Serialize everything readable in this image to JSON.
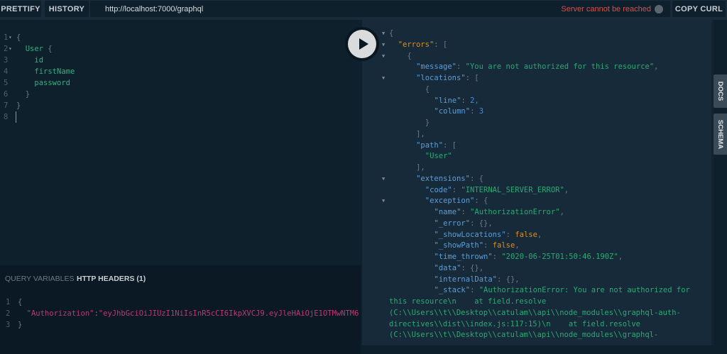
{
  "toolbar": {
    "prettify": "PRETTIFY",
    "history": "HISTORY",
    "url": "http://localhost:7000/graphql",
    "status": "Server cannot be reached",
    "copy_curl": "COPY CURL"
  },
  "side_tabs": {
    "docs": "DOCS",
    "schema": "SCHEMA"
  },
  "query": {
    "lines": [
      {
        "n": "1",
        "fold": true,
        "indent": 0,
        "tokens": [
          {
            "t": "{",
            "c": "punc"
          }
        ]
      },
      {
        "n": "2",
        "fold": true,
        "indent": 1,
        "tokens": [
          {
            "t": "User",
            "c": "green"
          },
          {
            "t": " {",
            "c": "punc"
          }
        ]
      },
      {
        "n": "3",
        "indent": 2,
        "tokens": [
          {
            "t": "id",
            "c": "green"
          }
        ]
      },
      {
        "n": "4",
        "indent": 2,
        "tokens": [
          {
            "t": "firstName",
            "c": "green"
          }
        ]
      },
      {
        "n": "5",
        "indent": 2,
        "tokens": [
          {
            "t": "password",
            "c": "green"
          }
        ]
      },
      {
        "n": "6",
        "indent": 1,
        "tokens": [
          {
            "t": "}",
            "c": "punc"
          }
        ]
      },
      {
        "n": "7",
        "indent": 0,
        "tokens": [
          {
            "t": "}",
            "c": "punc"
          }
        ]
      },
      {
        "n": "8",
        "indent": 0,
        "tokens": []
      }
    ]
  },
  "bottom_panel": {
    "tabs": [
      "QUERY VARIABLES",
      "HTTP HEADERS (1)"
    ],
    "active": 1,
    "lines": [
      {
        "n": "1",
        "tokens": [
          {
            "t": "{",
            "c": "punc"
          }
        ]
      },
      {
        "n": "2",
        "tokens": [
          {
            "t": "  \"Authorization\"",
            "c": "pink"
          },
          {
            "t": ":",
            "c": "punc"
          },
          {
            "t": "\"eyJhbGciOiJIUzI1NiIsInR5cCI6IkpXVCJ9.eyJleHAiOjE1OTMwNTM6",
            "c": "pink"
          }
        ]
      },
      {
        "n": "3",
        "tokens": [
          {
            "t": "}",
            "c": "punc"
          }
        ]
      }
    ]
  },
  "result": {
    "lines": [
      {
        "fold": true,
        "indent": 0,
        "tokens": [
          {
            "t": "{",
            "c": "punc"
          }
        ]
      },
      {
        "fold": true,
        "indent": 1,
        "tokens": [
          {
            "t": "\"errors\"",
            "c": "orange"
          },
          {
            "t": ": [",
            "c": "punc"
          }
        ]
      },
      {
        "fold": true,
        "indent": 2,
        "tokens": [
          {
            "t": "{",
            "c": "punc"
          }
        ]
      },
      {
        "indent": 3,
        "tokens": [
          {
            "t": "\"message\"",
            "c": "blue"
          },
          {
            "t": ": ",
            "c": "punc"
          },
          {
            "t": "\"You are not authorized for this resource\"",
            "c": "str"
          },
          {
            "t": ",",
            "c": "punc"
          }
        ]
      },
      {
        "fold": true,
        "indent": 3,
        "tokens": [
          {
            "t": "\"locations\"",
            "c": "blue"
          },
          {
            "t": ": [",
            "c": "punc"
          }
        ]
      },
      {
        "indent": 4,
        "tokens": [
          {
            "t": "{",
            "c": "punc"
          }
        ]
      },
      {
        "indent": 5,
        "tokens": [
          {
            "t": "\"line\"",
            "c": "blue"
          },
          {
            "t": ": ",
            "c": "punc"
          },
          {
            "t": "2",
            "c": "num"
          },
          {
            "t": ",",
            "c": "punc"
          }
        ]
      },
      {
        "indent": 5,
        "tokens": [
          {
            "t": "\"column\"",
            "c": "blue"
          },
          {
            "t": ": ",
            "c": "punc"
          },
          {
            "t": "3",
            "c": "num"
          }
        ]
      },
      {
        "indent": 4,
        "tokens": [
          {
            "t": "}",
            "c": "punc"
          }
        ]
      },
      {
        "indent": 3,
        "tokens": [
          {
            "t": "],",
            "c": "punc"
          }
        ]
      },
      {
        "indent": 3,
        "tokens": [
          {
            "t": "\"path\"",
            "c": "blue"
          },
          {
            "t": ": [",
            "c": "punc"
          }
        ]
      },
      {
        "indent": 4,
        "tokens": [
          {
            "t": "\"User\"",
            "c": "str"
          }
        ]
      },
      {
        "indent": 3,
        "tokens": [
          {
            "t": "],",
            "c": "punc"
          }
        ]
      },
      {
        "fold": true,
        "indent": 3,
        "tokens": [
          {
            "t": "\"extensions\"",
            "c": "blue"
          },
          {
            "t": ": {",
            "c": "punc"
          }
        ]
      },
      {
        "indent": 4,
        "tokens": [
          {
            "t": "\"code\"",
            "c": "blue"
          },
          {
            "t": ": ",
            "c": "punc"
          },
          {
            "t": "\"INTERNAL_SERVER_ERROR\"",
            "c": "str"
          },
          {
            "t": ",",
            "c": "punc"
          }
        ]
      },
      {
        "fold": true,
        "indent": 4,
        "tokens": [
          {
            "t": "\"exception\"",
            "c": "blue"
          },
          {
            "t": ": {",
            "c": "punc"
          }
        ]
      },
      {
        "indent": 5,
        "tokens": [
          {
            "t": "\"name\"",
            "c": "blue"
          },
          {
            "t": ": ",
            "c": "punc"
          },
          {
            "t": "\"AuthorizationError\"",
            "c": "str"
          },
          {
            "t": ",",
            "c": "punc"
          }
        ]
      },
      {
        "indent": 5,
        "tokens": [
          {
            "t": "\"_error\"",
            "c": "blue"
          },
          {
            "t": ": {},",
            "c": "punc"
          }
        ]
      },
      {
        "indent": 5,
        "tokens": [
          {
            "t": "\"_showLocations\"",
            "c": "blue"
          },
          {
            "t": ": ",
            "c": "punc"
          },
          {
            "t": "false",
            "c": "orange"
          },
          {
            "t": ",",
            "c": "punc"
          }
        ]
      },
      {
        "indent": 5,
        "tokens": [
          {
            "t": "\"_showPath\"",
            "c": "blue"
          },
          {
            "t": ": ",
            "c": "punc"
          },
          {
            "t": "false",
            "c": "orange"
          },
          {
            "t": ",",
            "c": "punc"
          }
        ]
      },
      {
        "indent": 5,
        "tokens": [
          {
            "t": "\"time_thrown\"",
            "c": "blue"
          },
          {
            "t": ": ",
            "c": "punc"
          },
          {
            "t": "\"2020-06-25T01:50:46.190Z\"",
            "c": "str"
          },
          {
            "t": ",",
            "c": "punc"
          }
        ]
      },
      {
        "indent": 5,
        "tokens": [
          {
            "t": "\"data\"",
            "c": "blue"
          },
          {
            "t": ": {},",
            "c": "punc"
          }
        ]
      },
      {
        "indent": 5,
        "tokens": [
          {
            "t": "\"internalData\"",
            "c": "blue"
          },
          {
            "t": ": {},",
            "c": "punc"
          }
        ]
      },
      {
        "indent": 5,
        "tokens": [
          {
            "t": "\"_stack\"",
            "c": "blue"
          },
          {
            "t": ": ",
            "c": "punc"
          },
          {
            "t": "\"AuthorizationError: You are not authorized for",
            "c": "str"
          }
        ]
      },
      {
        "indent": 0,
        "tokens": [
          {
            "t": "this resource\\n    at field.resolve",
            "c": "str"
          }
        ]
      },
      {
        "indent": 0,
        "tokens": [
          {
            "t": "(C:\\\\Users\\\\t\\\\Desktop\\\\catulam\\\\api\\\\node_modules\\\\graphql-auth-",
            "c": "str"
          }
        ]
      },
      {
        "indent": 0,
        "tokens": [
          {
            "t": "directives\\\\dist\\\\index.js:117:15)\\n    at field.resolve",
            "c": "str"
          }
        ]
      },
      {
        "indent": 0,
        "tokens": [
          {
            "t": "(C:\\\\Users\\\\t\\\\Desktop\\\\catulam\\\\api\\\\node_modules\\\\graphql-",
            "c": "str"
          }
        ]
      }
    ]
  },
  "colors": {
    "editor_bg": "#0f202d",
    "result_bg": "#172a3a",
    "status_error": "#d2534d"
  }
}
